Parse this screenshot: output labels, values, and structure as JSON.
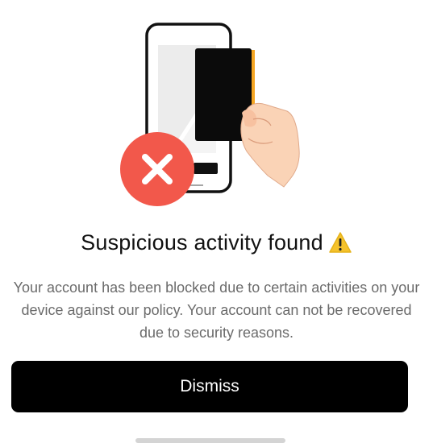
{
  "dialog": {
    "title": "Suspicious activity found",
    "title_icon": "warning-icon",
    "message": "Your account has been blocked due to certain activities on your device against our policy. Your account can not be recovered due to security reasons.",
    "dismiss_label": "Dismiss"
  },
  "illustration": {
    "icons": [
      "phone-illustration",
      "card-illustration",
      "hand-illustration",
      "error-x-icon"
    ]
  },
  "colors": {
    "accent_red": "#F2584B",
    "warning_yellow": "#F5C22B",
    "button_bg": "#000000",
    "text_primary": "#111111",
    "text_secondary": "#6B6B6B"
  }
}
